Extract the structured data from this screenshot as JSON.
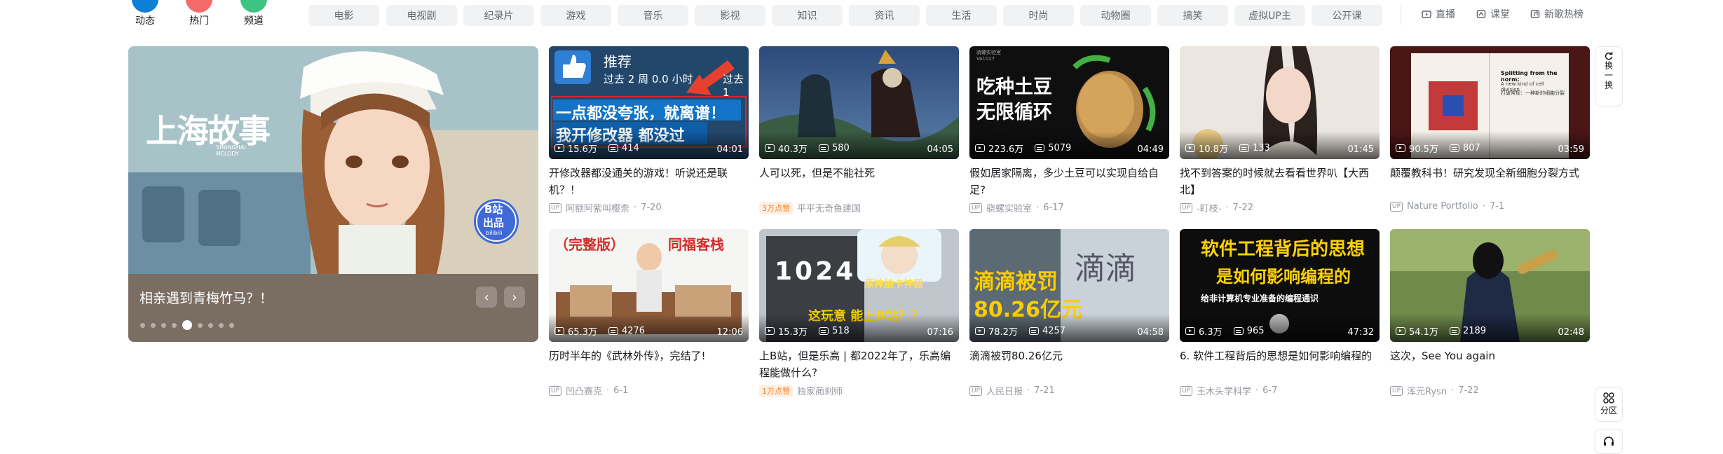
{
  "quick_nav": [
    {
      "label": "动态",
      "color": "#0e7fd6"
    },
    {
      "label": "热门",
      "color": "#f46a6a"
    },
    {
      "label": "频道",
      "color": "#3fc380"
    }
  ],
  "channels": [
    "电影",
    "电视剧",
    "纪录片",
    "游戏",
    "音乐",
    "影视",
    "知识",
    "资讯",
    "生活",
    "时尚",
    "动物圈",
    "搞笑",
    "虚拟UP主",
    "公开课"
  ],
  "right_links": [
    {
      "label": "直播",
      "icon": "live-tv-icon"
    },
    {
      "label": "课堂",
      "icon": "classroom-icon"
    },
    {
      "label": "新歌热榜",
      "icon": "music-chart-icon"
    }
  ],
  "carousel": {
    "title": "相亲遇到青梅竹马？！",
    "art_title": "上海故事",
    "art_subtitle": "SHANGHAI MELODY",
    "badge_line1": "B站",
    "badge_line2": "出品",
    "badge_line3": "bilibili",
    "prev": "‹",
    "next": "›",
    "dot_count": 9,
    "active_dot": 4
  },
  "up_tag": "UP",
  "videos": [
    {
      "title": "开修改器都没通关的游戏！听说还是联机？！",
      "author": "阿额阿紫叫樱柰",
      "date": "7-20",
      "views": "15.6万",
      "danmaku": "414",
      "duration": "04:01",
      "thumb_lines": [
        "推荐",
        "过去 2 周 0.0 小时",
        "过去 1",
        "一点都没夸张，就离谱！",
        "我开修改器 都没过"
      ]
    },
    {
      "title": "人可以死，但是不能社死",
      "author": "平平无奇鱼建国",
      "date": "",
      "views": "40.3万",
      "danmaku": "580",
      "duration": "04:05",
      "badge": "3万点赞",
      "thumb_lines": []
    },
    {
      "title": "假如居家隔离，多少土豆可以实现自给自足?",
      "author": "骁螺实验室",
      "date": "6-17",
      "views": "223.6万",
      "danmaku": "5079",
      "duration": "04:49",
      "thumb_lines": [
        "吃种土豆",
        "无限循环",
        "骁螺实验室",
        "Vol.017"
      ]
    },
    {
      "title": "找不到答案的时候就去看看世界叭【大西北】",
      "author": "-盯枝-",
      "date": "7-22",
      "views": "10.8万",
      "danmaku": "133",
      "duration": "01:45",
      "thumb_lines": []
    },
    {
      "title": "颠覆教科书！研究发现全新细胞分裂方式",
      "author": "Nature Portfolio",
      "date": "7-1",
      "views": "90.5万",
      "danmaku": "807",
      "duration": "03:59",
      "thumb_lines": [
        "Splitting from the norm:",
        "A new kind of cell division",
        "打破常规：一种新的细胞分裂"
      ]
    },
    {
      "title": "历时半年的《武林外传》，完结了!",
      "author": "凹凸赛克",
      "date": "6-1",
      "views": "65.3万",
      "danmaku": "4276",
      "duration": "12:06",
      "thumb_lines": [
        "（完整版）",
        "同福客栈"
      ]
    },
    {
      "title": "上B站，但是乐高 | 都2022年了，乐高编程能做什么?",
      "author": "独家蔺刹师",
      "date": "",
      "views": "15.3万",
      "danmaku": "518",
      "duration": "07:16",
      "badge": "1万点赞",
      "thumb_lines": [
        "原神抽卡神器",
        "这玩意 能上B站？？",
        "1024"
      ]
    },
    {
      "title": "滴滴被罚80.26亿元",
      "author": "人民日报",
      "date": "7-21",
      "views": "78.2万",
      "danmaku": "4257",
      "duration": "04:58",
      "thumb_lines": [
        "滴滴被罚",
        "80.26亿元",
        "滴滴"
      ]
    },
    {
      "title": "6. 软件工程背后的思想是如何影响编程的",
      "author": "王木头学科学",
      "date": "6-7",
      "views": "6.3万",
      "danmaku": "965",
      "duration": "47:32",
      "thumb_lines": [
        "软件工程背后的思想",
        "是如何影响编程的",
        "给非计算机专业准备的编程通识"
      ]
    },
    {
      "title": "这次，See You again",
      "author": "浑元Rysn",
      "date": "7-22",
      "views": "54.1万",
      "danmaku": "2189",
      "duration": "02:48",
      "thumb_lines": []
    }
  ],
  "float": {
    "refresh": "换一换",
    "zone": "分区"
  }
}
